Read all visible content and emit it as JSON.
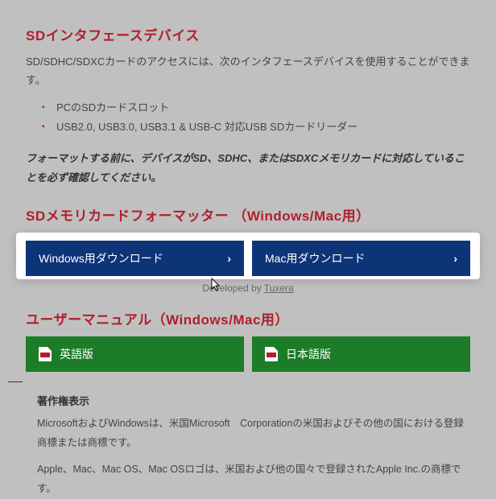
{
  "interface": {
    "heading": "SDインタフェースデバイス",
    "desc": "SD/SDHC/SDXCカードのアクセスには、次のインタフェースデバイスを使用することができます。",
    "bullets": [
      "PCのSDカードスロット",
      "USB2.0, USB3.0, USB3.1 & USB-C 対応USB SDカードリーダー"
    ],
    "warning": "フォーマットする前に、デバイスがSD、SDHC、またはSDXCメモリカードに対応していることを必ず確認してください。"
  },
  "formatter": {
    "heading": "SDメモリカードフォーマッター （Windows/Mac用）",
    "windows_label": "Windows用ダウンロード",
    "mac_label": "Mac用ダウンロード",
    "developed_by_prefix": "Developed by ",
    "developed_by_link": "Tuxera"
  },
  "manual": {
    "heading": "ユーザーマニュアル（Windows/Mac用）",
    "english_label": "英語版",
    "japanese_label": "日本語版"
  },
  "copyright": {
    "heading": "著作権表示",
    "lines": [
      "MicrosoftおよびWindowsは、米国Microsoft　Corporationの米国およびその他の国における登録商標または商標です。",
      "Apple、Mac、Mac OS、Mac OSロゴは、米国および他の国々で登録されたApple Inc.の商標です。"
    ]
  }
}
